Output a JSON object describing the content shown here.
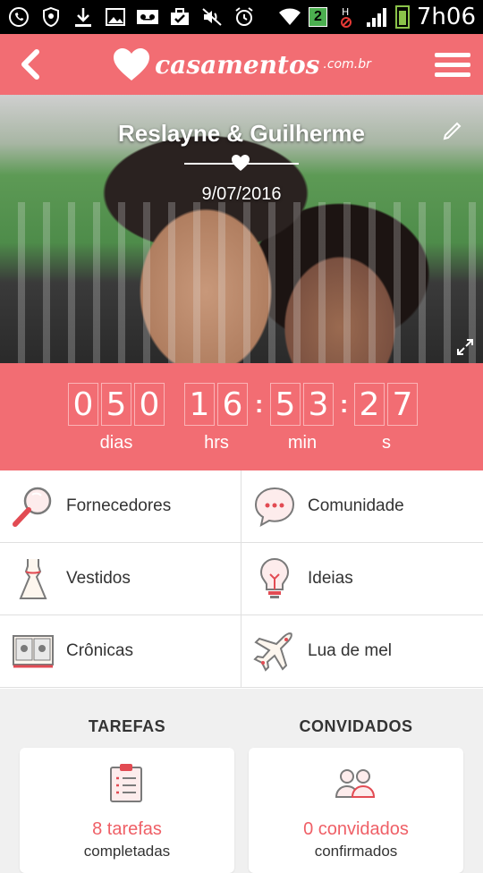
{
  "status_bar": {
    "time": "7h06",
    "sim_label": "2",
    "icons": [
      "whatsapp-icon",
      "shield-icon",
      "download-icon",
      "image-icon",
      "voicemail-icon",
      "briefcase-check-icon",
      "mute-icon",
      "alarm-icon",
      "wifi-icon",
      "sim-icon",
      "no-data-icon",
      "signal-icon",
      "battery-icon"
    ]
  },
  "app_bar": {
    "logo_text": "casamentos",
    "logo_domain": ".com.br",
    "back_icon": "chevron-left-icon",
    "menu_icon": "hamburger-menu-icon"
  },
  "hero": {
    "couple_names": "Reslayne & Guilherme",
    "wedding_date": "9/07/2016"
  },
  "countdown": {
    "days_digits": [
      "0",
      "5",
      "0"
    ],
    "hours_digits": [
      "1",
      "6"
    ],
    "minutes_digits": [
      "5",
      "3"
    ],
    "seconds_digits": [
      "2",
      "7"
    ],
    "separator": ":",
    "labels": {
      "days": "dias",
      "hours": "hrs",
      "minutes": "min",
      "seconds": "s"
    }
  },
  "menu": {
    "items": [
      {
        "label": "Fornecedores",
        "icon": "magnifier-icon"
      },
      {
        "label": "Comunidade",
        "icon": "chat-bubble-icon"
      },
      {
        "label": "Vestidos",
        "icon": "dress-icon"
      },
      {
        "label": "Ideias",
        "icon": "lightbulb-icon"
      },
      {
        "label": "Crônicas",
        "icon": "photo-album-icon"
      },
      {
        "label": "Lua de mel",
        "icon": "airplane-icon"
      }
    ]
  },
  "summary": {
    "tasks": {
      "title": "TAREFAS",
      "value": "8 tarefas",
      "subtitle": "completadas",
      "icon": "clipboard-icon"
    },
    "guests": {
      "title": "CONVIDADOS",
      "value": "0 convidados",
      "subtitle": "confirmados",
      "icon": "guests-icon"
    }
  },
  "colors": {
    "brand": "#f26d73",
    "accent_text": "#ef5f66",
    "background": "#f0f0f0"
  }
}
